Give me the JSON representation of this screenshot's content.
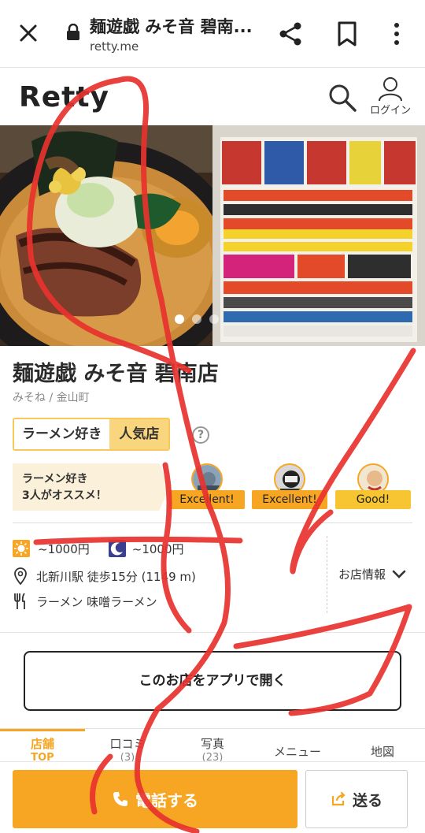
{
  "browser": {
    "page_title": "麺遊戯 みそ音 碧南...",
    "url": "retty.me",
    "icons": [
      "close-icon",
      "lock-icon",
      "share-icon",
      "bookmark-icon",
      "more-vert-icon"
    ]
  },
  "header": {
    "logo": "Retty",
    "login_label": "ログイン"
  },
  "photos": {
    "carousel_dots": 3,
    "active_dot": 0
  },
  "shop": {
    "name": "麺遊戯 みそ音 碧南店",
    "subtitle": "みそね / 金山町",
    "tags": [
      "ラーメン好き",
      "人気店"
    ],
    "help": "?",
    "recommend_line1": "ラーメン好き",
    "recommend_line2": "3人がオススメ！",
    "reviewers": [
      {
        "badge": "Excellent!"
      },
      {
        "badge": "Excellent!"
      },
      {
        "badge": "Good!"
      }
    ],
    "lunch_price": "~1000円",
    "dinner_price": "~1000円",
    "access": "北新川駅 徒歩15分 (1149 m)",
    "genre": "ラーメン 味噌ラーメン",
    "shop_info_label": "お店情報"
  },
  "open_app_label": "このお店をアプリで開く",
  "tabs": [
    {
      "label": "店舗",
      "sub": "TOP"
    },
    {
      "label": "口コミ",
      "sub": "(3)"
    },
    {
      "label": "写真",
      "sub": "(23)"
    },
    {
      "label": "メニュー",
      "sub": ""
    },
    {
      "label": "地図",
      "sub": ""
    }
  ],
  "actions": {
    "call_label": "電話する",
    "send_label": "送る"
  },
  "colors": {
    "accent": "#f6a623",
    "annotation": "#e8322e"
  }
}
